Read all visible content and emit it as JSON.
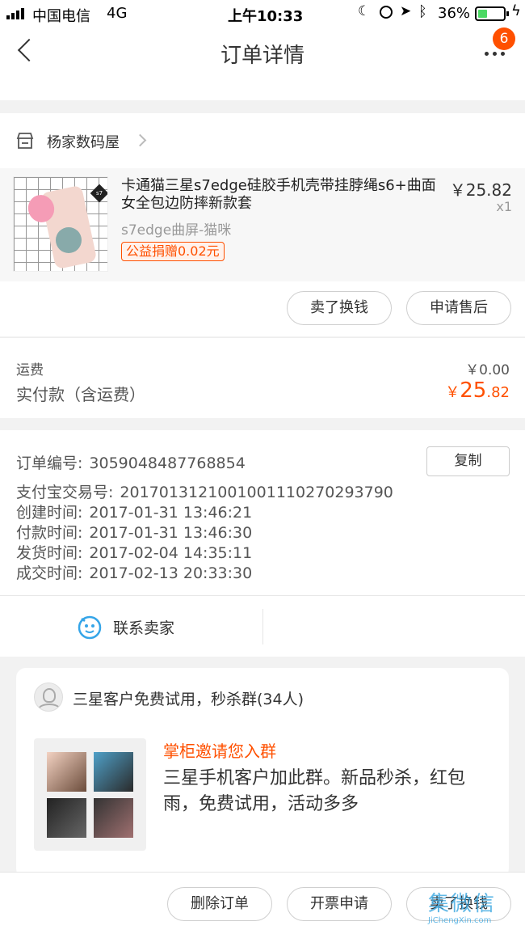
{
  "status_bar": {
    "carrier": "中国电信",
    "network": "4G",
    "time": "上午10:33",
    "battery": "36%",
    "battery_level": 0.36
  },
  "nav": {
    "title": "订单详情",
    "badge": "6"
  },
  "shop": {
    "name": "杨家数码屋"
  },
  "product": {
    "title": "卡通猫三星s7edge硅胶手机壳带挂脖绳s6+曲面女全包边防摔新款套",
    "spec": "s7edge曲屏-猫咪",
    "tag": "公益捐赠0.02元",
    "price": "￥25.82",
    "qty": "x1",
    "thumb_label": "s7"
  },
  "actions_item": {
    "sell": "卖了换钱",
    "after_sale": "申请售后"
  },
  "payment": {
    "shipping_label": "运费",
    "shipping_value": "￥0.00",
    "total_label": "实付款（含运费）",
    "total_symbol": "￥",
    "total_int": "25",
    "total_dec": ".82"
  },
  "order_info": {
    "copy_label": "复制",
    "rows": [
      {
        "label": "订单编号:",
        "value": "3059048487768854"
      },
      {
        "label": "支付宝交易号:",
        "value": "2017013121001001110270293790"
      },
      {
        "label": "创建时间:",
        "value": "2017-01-31 13:46:21"
      },
      {
        "label": "付款时间:",
        "value": "2017-01-31 13:46:30"
      },
      {
        "label": "发货时间:",
        "value": "2017-02-04 14:35:11"
      },
      {
        "label": "成交时间:",
        "value": "2017-02-13 20:33:30"
      }
    ]
  },
  "contact": {
    "label": "联系卖家"
  },
  "group": {
    "name": "三星客户免费试用，秒杀群(34人)",
    "invite": "掌柜邀请您入群",
    "desc": "三星手机客户加此群。新品秒杀，红包雨，免费试用，活动多多"
  },
  "bottom_bar": {
    "delete": "删除订单",
    "invoice": "开票申请",
    "sell": "卖了换钱"
  },
  "watermark": {
    "chars": "集微信",
    "url": "JiChengXin.com"
  },
  "colors": {
    "accent": "#ff5000",
    "badge": "#ff5000",
    "contact_icon": "#35a5e8"
  }
}
